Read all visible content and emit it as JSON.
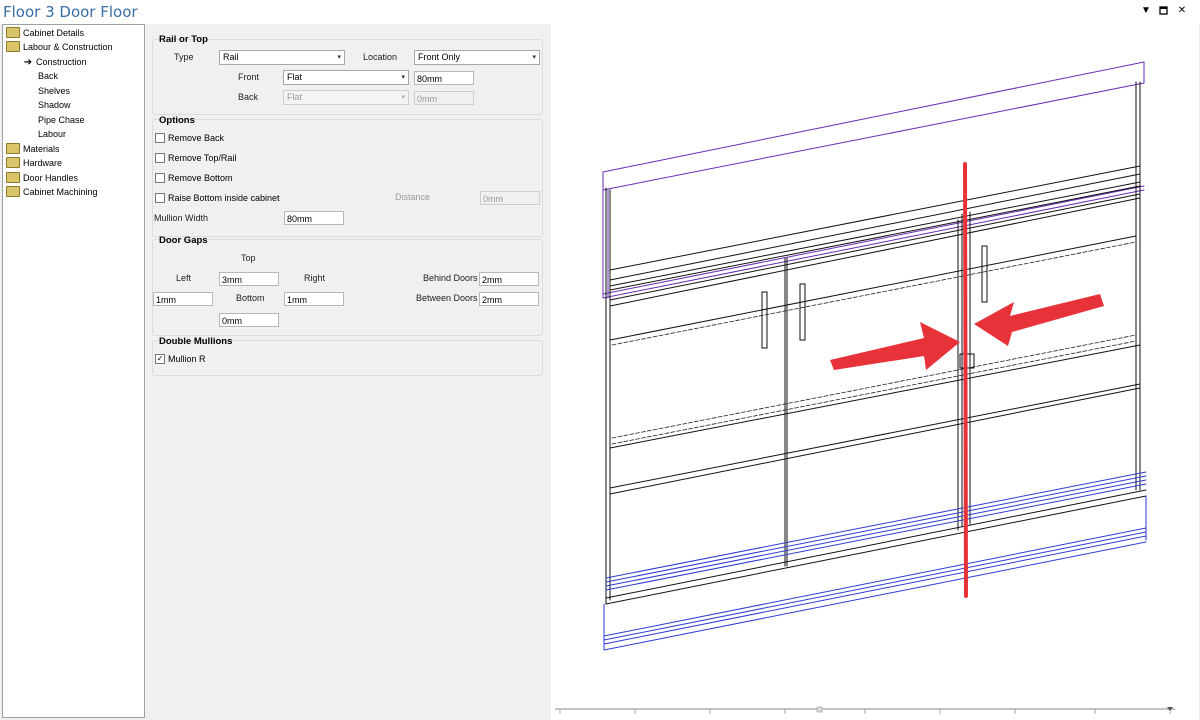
{
  "window": {
    "title": "Floor 3 Door Floor"
  },
  "tree": {
    "items": [
      {
        "label": "Cabinet Details",
        "type": "folder"
      },
      {
        "label": "Labour & Construction",
        "type": "folder"
      },
      {
        "label": "Construction",
        "type": "arrow"
      },
      {
        "label": "Back",
        "type": "child"
      },
      {
        "label": "Shelves",
        "type": "child"
      },
      {
        "label": "Shadow",
        "type": "child"
      },
      {
        "label": "Pipe Chase",
        "type": "child"
      },
      {
        "label": "Labour",
        "type": "child"
      },
      {
        "label": "Materials",
        "type": "folder"
      },
      {
        "label": "Hardware",
        "type": "folder"
      },
      {
        "label": "Door Handles",
        "type": "folder"
      },
      {
        "label": "Cabinet Machining",
        "type": "folder"
      }
    ]
  },
  "rail": {
    "title": "Rail or Top",
    "type_label": "Type",
    "type_value": "Rail",
    "location_label": "Location",
    "location_value": "Front Only",
    "front_label": "Front",
    "front_value": "Flat",
    "front_size": "80mm",
    "back_label": "Back",
    "back_value": "Flat",
    "back_size": "0mm"
  },
  "options": {
    "title": "Options",
    "remove_back": "Remove Back",
    "remove_top": "Remove Top/Rail",
    "remove_bottom": "Remove Bottom",
    "raise_bottom": "Raise Bottom inside cabinet",
    "distance_label": "Distance",
    "distance_value": "0mm",
    "mullion_width_label": "Mullion Width",
    "mullion_width_value": "80mm"
  },
  "door_gaps": {
    "title": "Door Gaps",
    "top_label": "Top",
    "top_value": "3mm",
    "left_label": "Left",
    "left_value": "1mm",
    "right_label": "Right",
    "right_value": "1mm",
    "bottom_label": "Bottom",
    "bottom_value": "0mm",
    "behind_label": "Behind Doors",
    "behind_value": "2mm",
    "between_label": "Between Doors",
    "between_value": "2mm"
  },
  "double_mullions": {
    "title": "Double Mullions",
    "mullion_r": "Mullion R",
    "mullion_r_checked": true
  },
  "icons": {
    "checked_mark": "✓",
    "caret": "▾"
  },
  "colors": {
    "title": "#3a6ea5",
    "annotation": "#e8323a",
    "outline": "#6a2bb3",
    "floor_lines": "#2e3bd1"
  }
}
